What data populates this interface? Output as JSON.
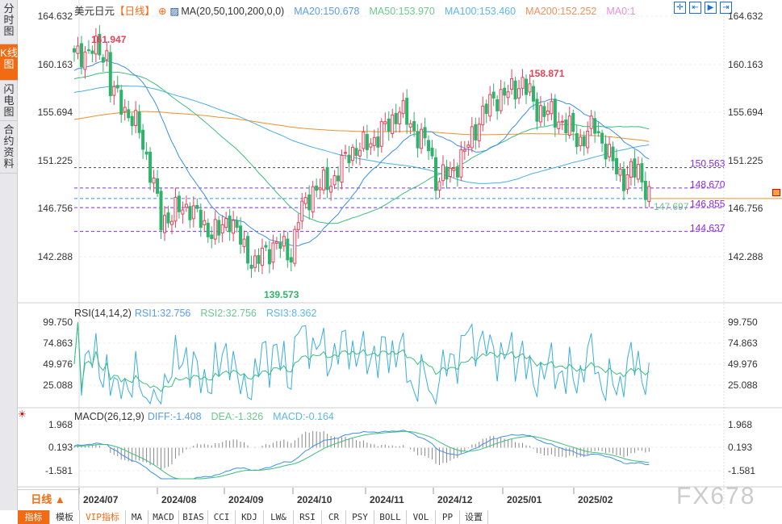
{
  "sidebar": {
    "tabs": [
      {
        "label": "分时图",
        "active": false
      },
      {
        "label": "K线图",
        "active": true
      },
      {
        "label": "闪电图",
        "active": false
      },
      {
        "label": "合约资料",
        "active": false
      }
    ]
  },
  "header": {
    "symbol": "美元日元",
    "period": "【日线】",
    "ma_label": "MA(20,50,100,200,0,0)",
    "ma20": "MA20:150.678",
    "ma50": "MA50:153.970",
    "ma100": "MA100:153.460",
    "ma200": "MA200:152.252",
    "ma0": "MA0:1"
  },
  "price_axis": [
    "164.632",
    "160.163",
    "155.694",
    "151.225",
    "146.756",
    "142.288"
  ],
  "annotations": {
    "high": "161.947",
    "low": "139.573",
    "high2": "158.871",
    "last": "147.697"
  },
  "levels": [
    "150.563",
    "148.670",
    "146.855",
    "144.637"
  ],
  "rsi": {
    "label": "RSI(14,14,2)",
    "rsi1": "RSI1:32.756",
    "rsi2": "RSI2:32.756",
    "rsi3": "RSI3:8.362",
    "axis": [
      "99.750",
      "74.863",
      "49.976",
      "25.088"
    ]
  },
  "macd": {
    "label": "MACD(26,12,9)",
    "diff": "DIFF:-1.408",
    "dea": "DEA:-1.326",
    "macd": "MACD:-0.164",
    "axis": [
      "1.968",
      "0.193",
      "-1.581"
    ]
  },
  "period_selector": "日线 ▲",
  "dates": [
    "2024/07",
    "2024/08",
    "2024/09",
    "2024/10",
    "2024/11",
    "2024/12",
    "2025/01",
    "2025/02"
  ],
  "toolbar": [
    "指标",
    "模板",
    "VIP指标",
    "MA",
    "MACD",
    "BIAS",
    "CCI",
    "KDJ",
    "LW&",
    "RSI",
    "CR",
    "PSY",
    "BOLL",
    "VOL",
    "PP",
    "设置"
  ],
  "watermark": "FX678",
  "colors": {
    "up": "#e8415a",
    "down": "#2fb36b",
    "ma20": "#3b8fe8",
    "ma50": "#3cbf7a",
    "ma100": "#4ab0e0",
    "ma200": "#f0902a",
    "level": "#8b2be2"
  },
  "chart_data": {
    "type": "candlestick",
    "title": "美元日元 日线",
    "close_keypoints": [
      [
        0,
        160.8
      ],
      [
        5,
        161.6
      ],
      [
        9,
        161
      ],
      [
        10,
        158
      ],
      [
        14,
        156
      ],
      [
        18,
        154
      ],
      [
        22,
        149
      ],
      [
        24,
        145.5
      ],
      [
        28,
        146.5
      ],
      [
        32,
        147
      ],
      [
        36,
        145
      ],
      [
        40,
        144.5
      ],
      [
        43,
        146
      ],
      [
        47,
        143
      ],
      [
        50,
        141.5
      ],
      [
        52,
        142.5
      ],
      [
        56,
        143.5
      ],
      [
        60,
        142.5
      ],
      [
        62,
        146
      ],
      [
        66,
        148.5
      ],
      [
        72,
        149.5
      ],
      [
        76,
        152
      ],
      [
        80,
        152.5
      ],
      [
        84,
        153.5
      ],
      [
        88,
        155
      ],
      [
        90,
        156
      ],
      [
        94,
        154
      ],
      [
        98,
        152.5
      ],
      [
        100,
        149.5
      ],
      [
        104,
        150
      ],
      [
        108,
        152
      ],
      [
        112,
        155
      ],
      [
        116,
        157
      ],
      [
        120,
        157.5
      ],
      [
        124,
        158.5
      ],
      [
        128,
        156
      ],
      [
        132,
        155.5
      ],
      [
        136,
        154.5
      ],
      [
        140,
        153
      ],
      [
        144,
        154.5
      ],
      [
        148,
        151.5
      ],
      [
        152,
        149.5
      ],
      [
        156,
        150.5
      ],
      [
        159,
        147.7
      ]
    ],
    "ylim": [
      139.5,
      164.632
    ]
  }
}
